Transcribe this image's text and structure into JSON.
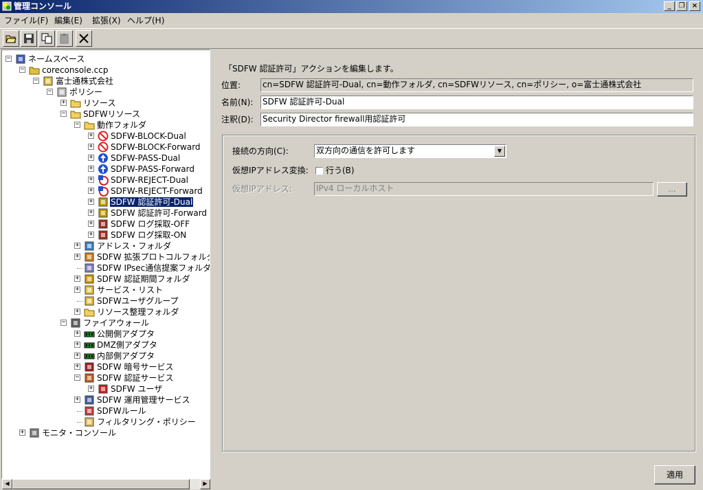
{
  "window": {
    "title": "管理コンソール",
    "minimize": "_",
    "restore": "❐",
    "close": "×"
  },
  "menu": [
    {
      "label": "ファイル(F)"
    },
    {
      "label": "編集(E)"
    },
    {
      "label": "拡張(X)"
    },
    {
      "label": "ヘルプ(H)"
    }
  ],
  "tree": {
    "nodes": [
      {
        "label": "ネームスペース",
        "icon": "namespace-icon"
      },
      {
        "label": "coreconsole.ccp",
        "icon": "console-folder-icon"
      },
      {
        "label": "富士通株式会社",
        "icon": "organization-icon"
      },
      {
        "label": "ポリシー",
        "icon": "database-icon"
      },
      {
        "label": "リソース",
        "icon": "folder-icon"
      },
      {
        "label": "SDFWリソース",
        "icon": "open-folder-icon"
      },
      {
        "label": "動作フォルダ",
        "icon": "open-folder-icon"
      },
      {
        "label": "SDFW-BLOCK-Dual",
        "icon": "block-icon"
      },
      {
        "label": "SDFW-BLOCK-Forward",
        "icon": "block-icon"
      },
      {
        "label": "SDFW-PASS-Dual",
        "icon": "pass-icon"
      },
      {
        "label": "SDFW-PASS-Forward",
        "icon": "pass-icon"
      },
      {
        "label": "SDFW-REJECT-Dual",
        "icon": "reject-icon"
      },
      {
        "label": "SDFW-REJECT-Forward",
        "icon": "reject-icon"
      },
      {
        "label": "SDFW 認証許可-Dual",
        "icon": "auth-icon"
      },
      {
        "label": "SDFW 認証許可-Forward",
        "icon": "auth-icon"
      },
      {
        "label": "SDFW ログ採取-OFF",
        "icon": "log-icon"
      },
      {
        "label": "SDFW ログ採取-ON",
        "icon": "log-icon"
      },
      {
        "label": "アドレス・フォルダ",
        "icon": "address-icon"
      },
      {
        "label": "SDFW 拡張プロトコルフォルダ",
        "icon": "protocol-icon"
      },
      {
        "label": "SDFW IPsec通信提案フォルダ",
        "icon": "ipsec-icon"
      },
      {
        "label": "SDFW 認証期間フォルダ",
        "icon": "auth-period-icon"
      },
      {
        "label": "サービス・リスト",
        "icon": "service-list-icon"
      },
      {
        "label": "SDFWユーザグループ",
        "icon": "user-group-icon"
      },
      {
        "label": "リソース整理フォルダ",
        "icon": "folder-icon"
      },
      {
        "label": "ファイアウォール",
        "icon": "firewall-icon"
      },
      {
        "label": "公開側アダプタ",
        "icon": "adapter-icon"
      },
      {
        "label": "DMZ側アダプタ",
        "icon": "adapter-icon"
      },
      {
        "label": "内部側アダプタ",
        "icon": "adapter-icon"
      },
      {
        "label": "SDFW 暗号サービス",
        "icon": "crypto-service-icon"
      },
      {
        "label": "SDFW 認証サービス",
        "icon": "auth-service-icon"
      },
      {
        "label": "SDFW ユーザ",
        "icon": "user-icon"
      },
      {
        "label": "SDFW 運用管理サービス",
        "icon": "admin-service-icon"
      },
      {
        "label": "SDFWルール",
        "icon": "rule-icon"
      },
      {
        "label": "フィルタリング・ポリシー",
        "icon": "policy-doc-icon"
      },
      {
        "label": "モニタ・コンソール",
        "icon": "monitor-icon"
      }
    ]
  },
  "editor": {
    "heading": "「SDFW 認証許可」アクションを編集します。",
    "location_label": "位置:",
    "location_value": "cn=SDFW 認証許可-Dual, cn=動作フォルダ, cn=SDFWリソース, cn=ポリシー, o=富士通株式会社",
    "name_label": "名前(N):",
    "name_value": "SDFW 認証許可-Dual",
    "note_label": "注釈(D):",
    "note_value": "Security Director firewall用認証許可",
    "direction_label": "接続の方向(C):",
    "direction_value": "双方向の通信を許可します",
    "vip_conv_label": "仮想IPアドレス変換:",
    "vip_checkbox_label": "行う(B)",
    "vip_checked": false,
    "vip_addr_label": "仮想IPアドレス:",
    "vip_addr_value": "IPv4 ローカルホスト",
    "browse_label": "...",
    "apply_label": "適用"
  },
  "colors": {
    "selection": "#0a246a",
    "face": "#d4d0c8"
  }
}
